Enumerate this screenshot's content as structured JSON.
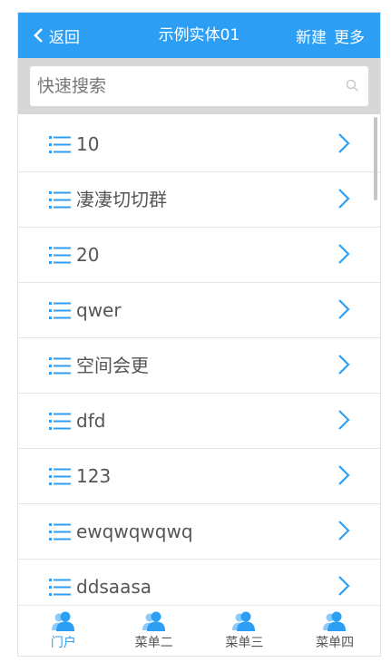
{
  "header": {
    "back_label": "返回",
    "title": "示例实体01",
    "new_label": "新建",
    "more_label": "更多"
  },
  "search": {
    "placeholder": "快速搜索",
    "value": ""
  },
  "list": {
    "items": [
      {
        "label": "10"
      },
      {
        "label": "凄凄切切群"
      },
      {
        "label": "20"
      },
      {
        "label": "qwer"
      },
      {
        "label": "空间会更"
      },
      {
        "label": "dfd"
      },
      {
        "label": "123"
      },
      {
        "label": "ewqwqwqwq"
      },
      {
        "label": "ddsaasa"
      }
    ]
  },
  "tabbar": {
    "tabs": [
      {
        "label": "门户",
        "active": true
      },
      {
        "label": "菜单二"
      },
      {
        "label": "菜单三"
      },
      {
        "label": "菜单四"
      }
    ]
  },
  "colors": {
    "accent": "#2c9ff5",
    "text": "#555555",
    "searchbar_bg": "#d7d7d7"
  },
  "icons": {
    "back": "chevron-left-icon",
    "search": "search-icon",
    "row": "list-icon",
    "row_arrow": "chevron-right-icon",
    "tab": "user-group-icon"
  }
}
